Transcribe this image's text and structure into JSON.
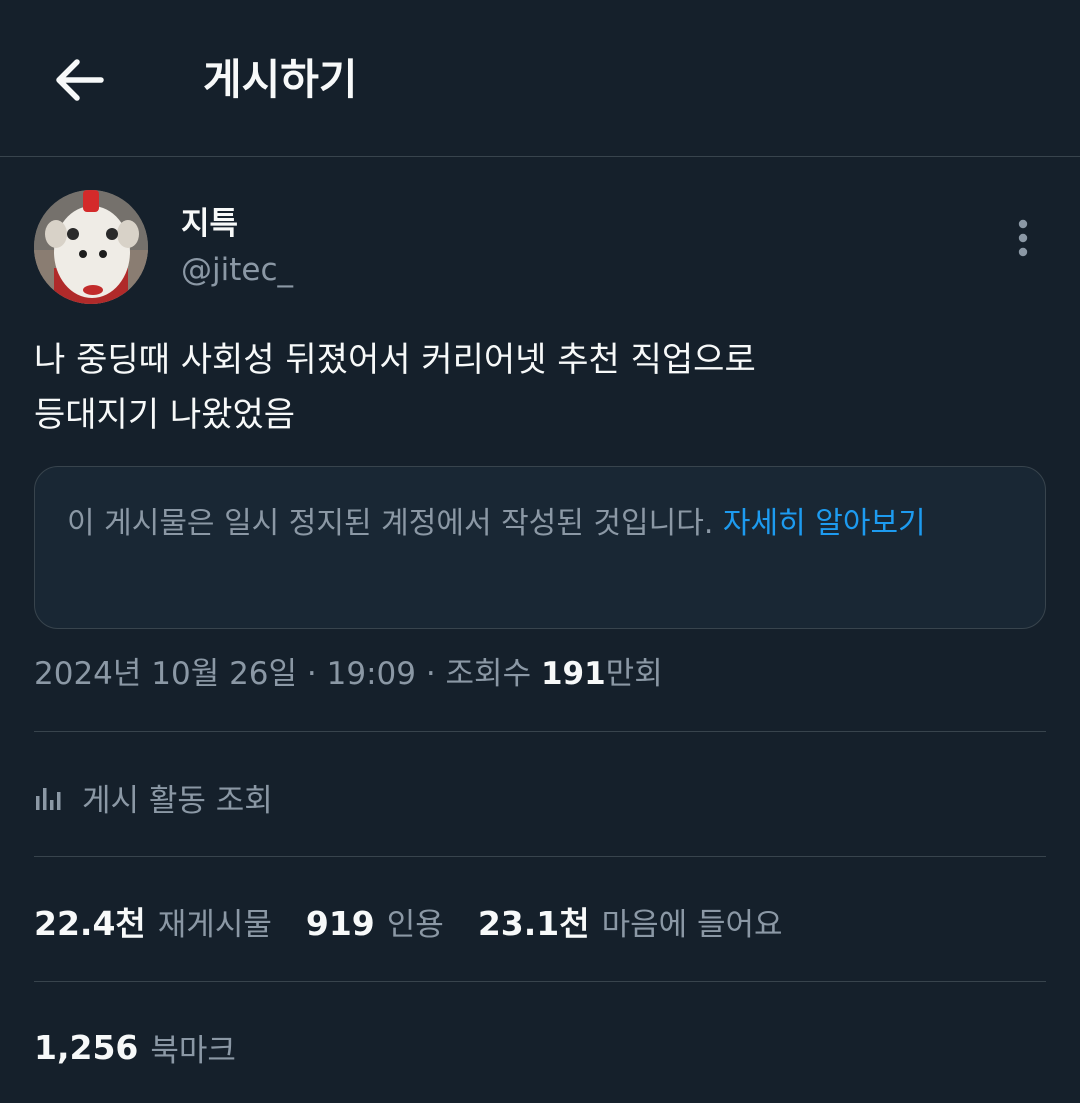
{
  "header": {
    "title": "게시하기",
    "back_icon": "arrow-left-icon"
  },
  "author": {
    "display_name": "지특",
    "handle": "@jitec_",
    "avatar_icon": "avatar-image"
  },
  "tweet": {
    "lines": [
      "나 중딩때 사회성 뒤졌어서 커리어넷 추천 직업으로",
      "등대지기 나왔었음"
    ]
  },
  "notice": {
    "text": "이 게시물은 일시 정지된 계정에서 작성된 것입니다.",
    "link": "자세히 알아보기"
  },
  "meta": {
    "date": "2024년 10월 26일",
    "separator": " · ",
    "time": "19:09",
    "views_label": "조회수",
    "views_count": "191",
    "views_unit": "만회"
  },
  "activity": {
    "label": "게시 활동 조회",
    "icon": "analytics-bars-icon"
  },
  "stats": {
    "reposts": {
      "count": "22.4천",
      "label": "재게시물"
    },
    "quotes": {
      "count": "919",
      "label": "인용"
    },
    "likes": {
      "count": "23.1천",
      "label": "마음에 들어요"
    },
    "bookmarks": {
      "count": "1,256",
      "label": "북마크"
    }
  },
  "colors": {
    "background": "#15202b",
    "text_primary": "#f7f9f9",
    "text_secondary": "#8b98a5",
    "link": "#1d9bf0",
    "border": "#38444d"
  }
}
